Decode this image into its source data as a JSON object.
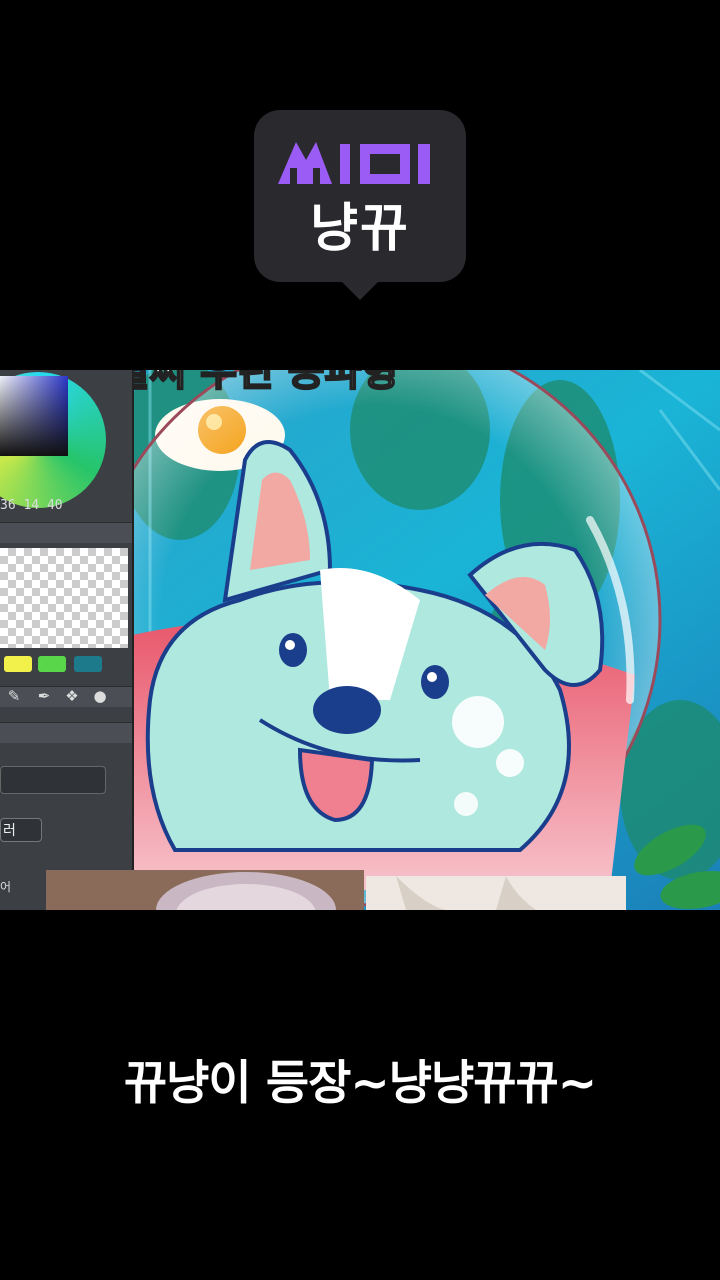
{
  "badge": {
    "logo_text": "ᄊIᄆI",
    "name": "냥뀨",
    "logo_color": "#9b5cf6"
  },
  "video": {
    "top_caption": "잘 될써 우린 공파형",
    "tool_panel": {
      "hsv_readout": "36   14   40",
      "dropdown_label": "러",
      "bottom_label": "어",
      "swatch_colors": [
        "#f2f04a",
        "#5ad64a",
        "#1d7a8a"
      ]
    }
  },
  "subtitle": "뀨냥이 등장~냥냥뀨뀨~"
}
